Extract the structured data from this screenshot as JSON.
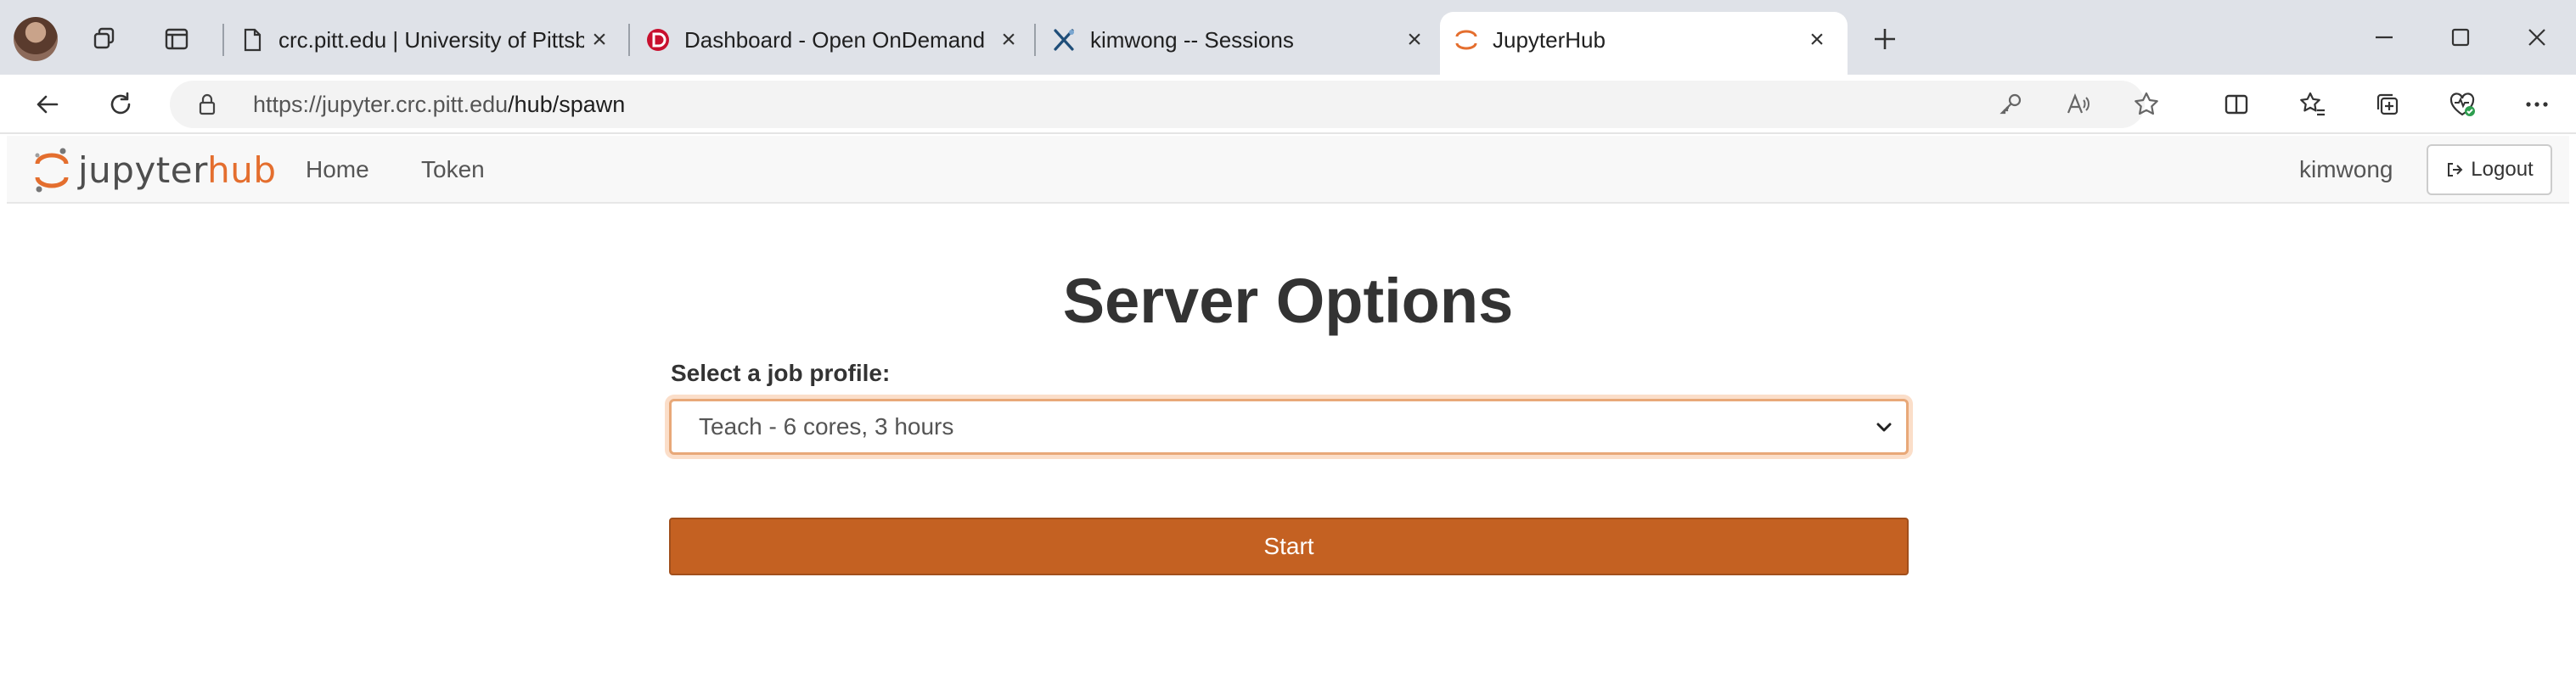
{
  "browser": {
    "tabs": [
      {
        "title": "crc.pitt.edu | University of Pittsbur",
        "favicon": "page-icon"
      },
      {
        "title": "Dashboard - Open OnDemand",
        "favicon": "ondemand-icon"
      },
      {
        "title": "kimwong -- Sessions",
        "favicon": "xdmod-icon"
      },
      {
        "title": "JupyterHub",
        "favicon": "jupyter-icon",
        "active": true
      }
    ],
    "address": {
      "host": "https://jupyter.crc.pitt.edu",
      "path": "/hub/spawn"
    }
  },
  "jupyterhub": {
    "logo_prefix": "jupyter",
    "logo_suffix": "hub",
    "nav": {
      "home": "Home",
      "token": "Token"
    },
    "username": "kimwong",
    "logout_label": "Logout"
  },
  "form": {
    "title": "Server Options",
    "profile_label": "Select a job profile:",
    "profile_selected": "Teach - 6 cores, 3 hours",
    "start_label": "Start"
  },
  "colors": {
    "jupyter_orange": "#e46e2e",
    "start_button": "#c46122"
  }
}
